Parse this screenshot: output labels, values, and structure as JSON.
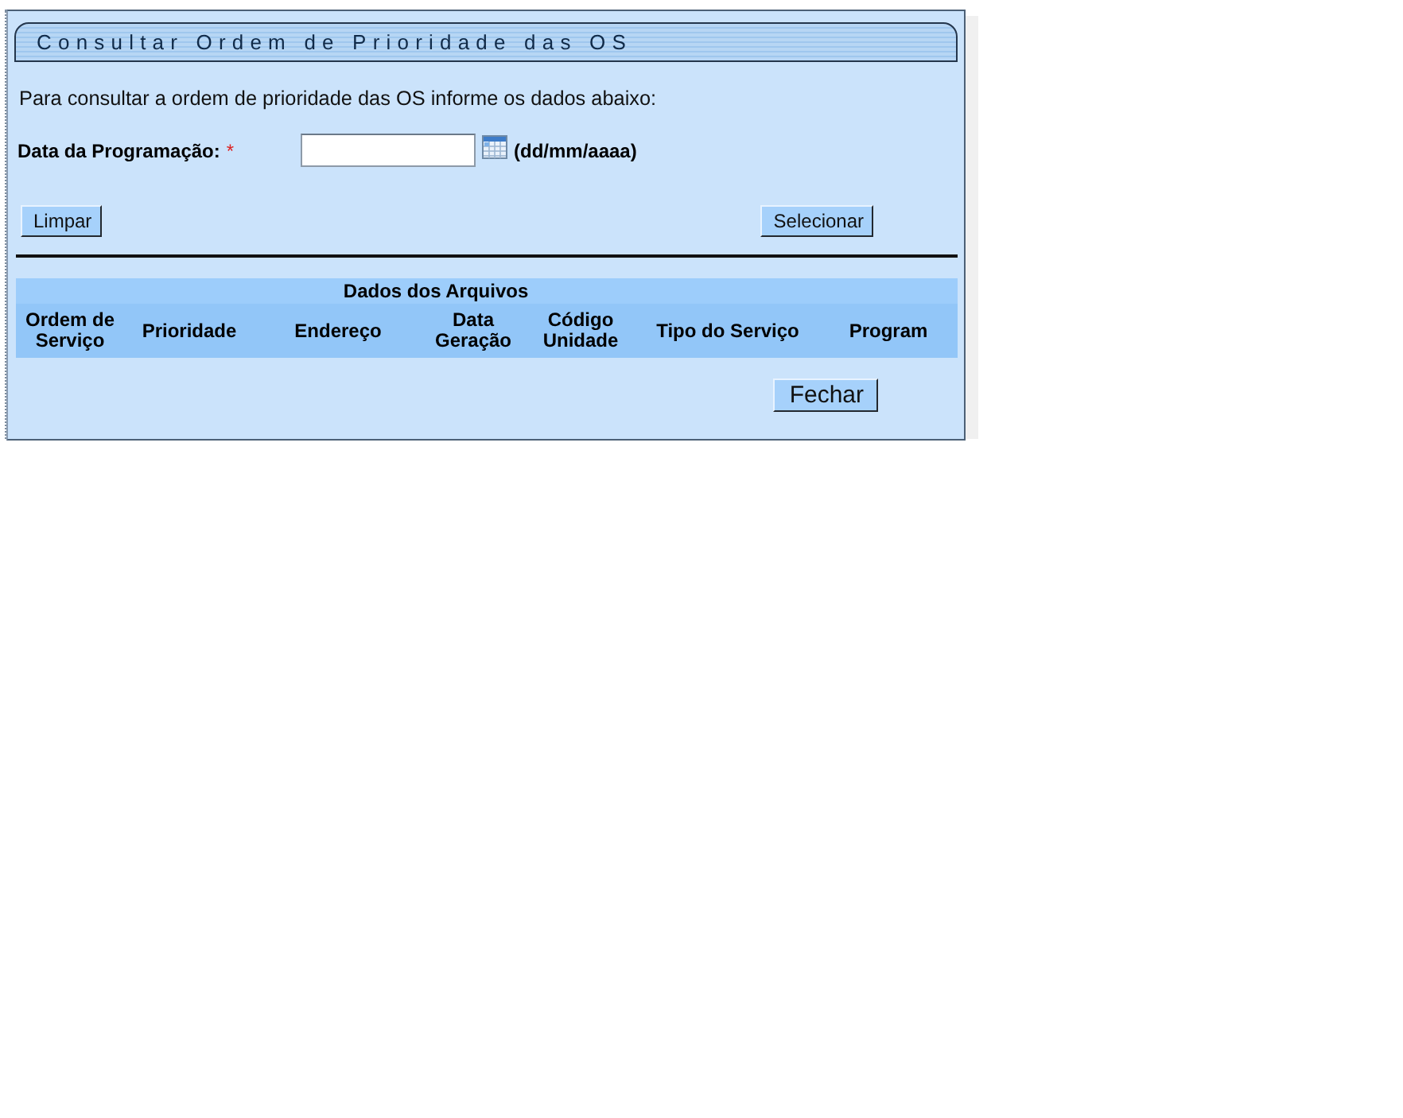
{
  "panel": {
    "title": "Consultar Ordem de Prioridade das OS",
    "instructions": "Para consultar a ordem de prioridade das OS informe os dados abaixo:"
  },
  "form": {
    "fields": [
      {
        "label": "Data da Programação:",
        "required_mark": "*",
        "hint": "(dd/mm/aaaa)"
      }
    ]
  },
  "actions": {
    "clear_button": "Limpar",
    "select_button": "Selecionar"
  },
  "table": {
    "title": "Dados dos Arquivos",
    "columns": [
      "Ordem de Serviço",
      "Prioridade",
      "Endereço",
      "Data Geração",
      "Código Unidade",
      "Tipo do Serviço",
      "Program"
    ]
  },
  "close_button": "Fechar"
}
